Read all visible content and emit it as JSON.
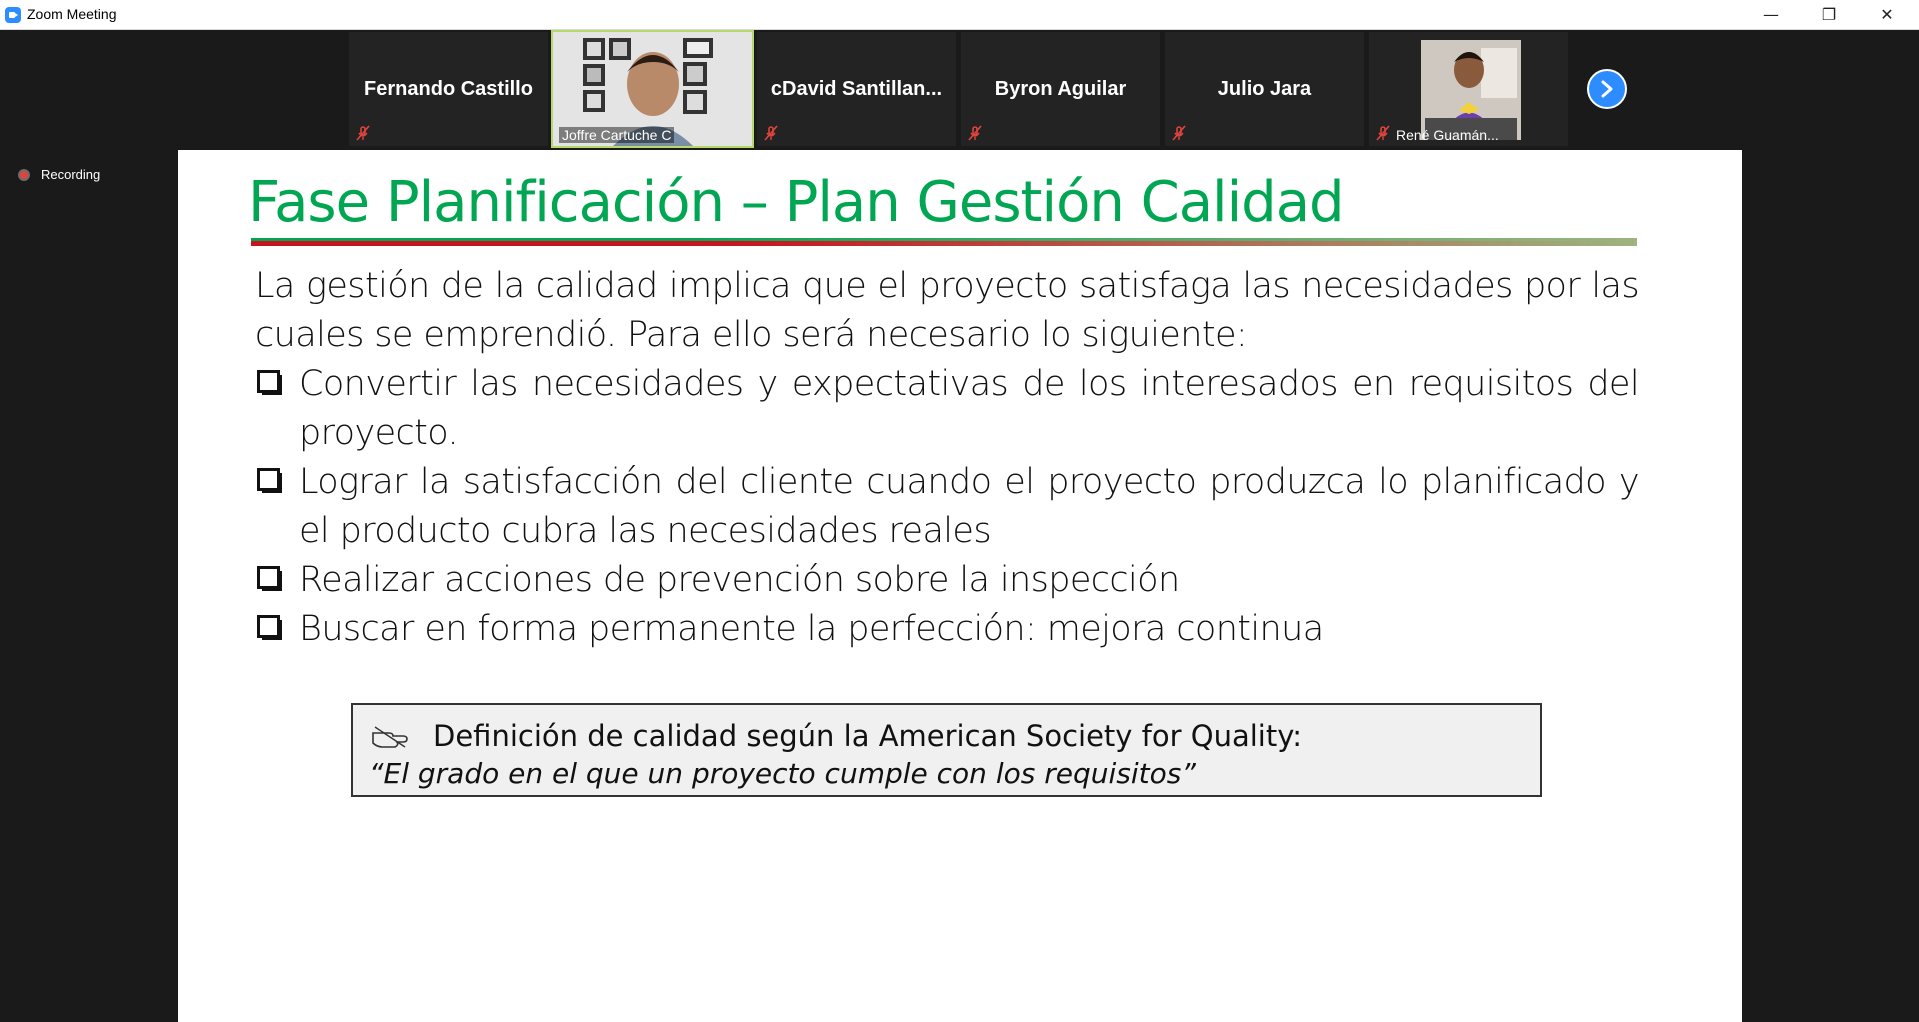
{
  "window": {
    "title": "Zoom Meeting",
    "minimize_glyph": "—",
    "restore_glyph": "❐",
    "close_glyph": "✕"
  },
  "participants": [
    {
      "name": "Fernando Castillo",
      "video": false,
      "muted": true
    },
    {
      "name": "Joffre Cartuche C",
      "video": true,
      "muted": false
    },
    {
      "name": "cDavid  Santillan...",
      "video": false,
      "muted": true
    },
    {
      "name": "Byron Aguilar",
      "video": false,
      "muted": true
    },
    {
      "name": "Julio Jara",
      "video": false,
      "muted": true
    },
    {
      "name": "René Guamán...",
      "video": true,
      "muted": true
    }
  ],
  "recording": {
    "label": "Recording"
  },
  "slide": {
    "title": "Fase Planificación – Plan Gestión Calidad",
    "intro": "La gestión de la calidad implica que el proyecto satisfaga las necesidades por las cuales se emprendió. Para ello será necesario lo siguiente:",
    "bullets": [
      "Convertir las necesidades y expectativas de los interesados en requisitos del proyecto.",
      "Lograr la satisfacción del cliente cuando el proyecto produzca lo planificado y el producto cubra las necesidades reales",
      "Realizar acciones de prevención sobre la inspección",
      "Buscar en forma permanente la perfección: mejora continua"
    ],
    "definition": {
      "heading": "Definición de calidad según la American Society for Quality:",
      "quote": "“El grado en el que un proyecto cumple con los requisitos”"
    }
  },
  "colors": {
    "title_green": "#00a651",
    "rule_red": "#c8141e",
    "zoom_blue": "#2d8cff",
    "recording_red": "#e0443e",
    "mute_red": "#e0443e"
  }
}
